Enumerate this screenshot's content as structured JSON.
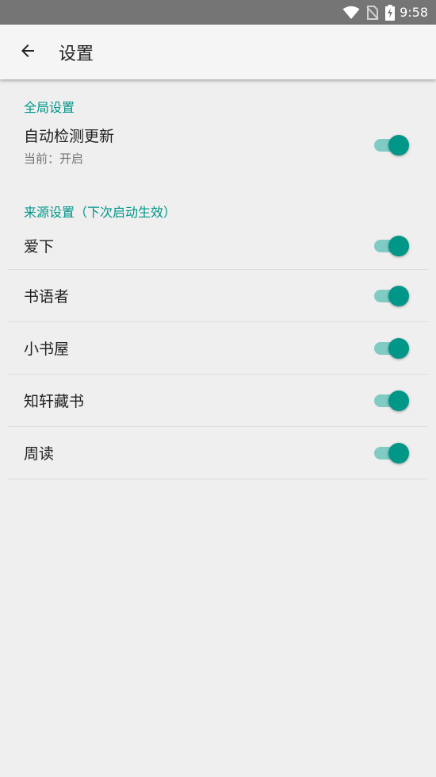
{
  "status_bar": {
    "time": "9:58"
  },
  "app_bar": {
    "title": "设置"
  },
  "global_section": {
    "header": "全局设置",
    "auto_update": {
      "title": "自动检测更新",
      "summary": "当前：开启",
      "enabled": true
    }
  },
  "source_section": {
    "header": "来源设置（下次启动生效）",
    "items": [
      {
        "label": "爱下",
        "enabled": true
      },
      {
        "label": "书语者",
        "enabled": true
      },
      {
        "label": "小书屋",
        "enabled": true
      },
      {
        "label": "知轩藏书",
        "enabled": true
      },
      {
        "label": "周读",
        "enabled": true
      }
    ]
  },
  "colors": {
    "accent": "#009688",
    "track": "#80cbc4",
    "status_bar": "#757575",
    "background": "#efefef"
  },
  "icons": {
    "back": "arrow-left-icon",
    "wifi": "wifi-icon",
    "sim": "no-sim-icon",
    "battery": "battery-charging-icon"
  }
}
